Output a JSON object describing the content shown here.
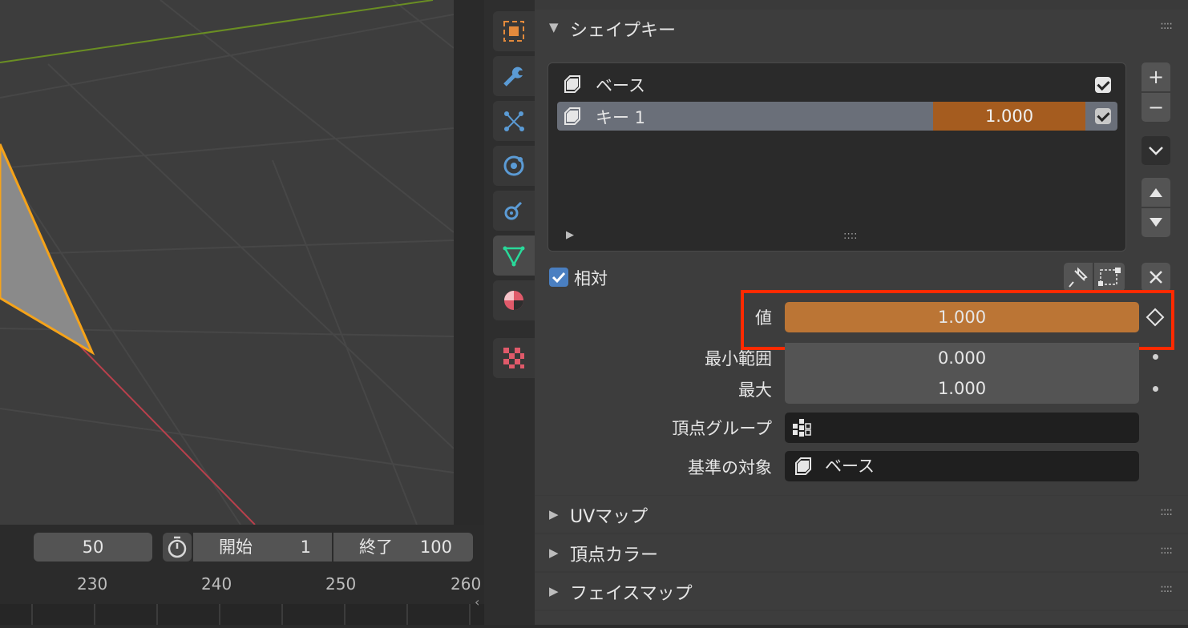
{
  "timeline": {
    "current_frame": "50",
    "start_label": "開始",
    "start_value": "1",
    "end_label": "終了",
    "end_value": "100",
    "ruler_numbers": [
      "230",
      "240",
      "250",
      "260"
    ]
  },
  "tabs": [
    "object-tab",
    "modifier-tab",
    "particles-tab",
    "physics-tab",
    "constraints-tab",
    "data-tab",
    "material-tab",
    "texture-tab"
  ],
  "shape_keys": {
    "title": "シェイプキー",
    "items": [
      {
        "name": "ベース",
        "value": "",
        "checked": true
      },
      {
        "name": "キー 1",
        "value": "1.000",
        "checked": true
      }
    ],
    "relative_label": "相対",
    "value_label": "値",
    "value": "1.000",
    "range_min_label": "最小範囲",
    "range_min": "0.000",
    "max_label": "最大",
    "max": "1.000",
    "vertex_group_label": "頂点グループ",
    "vertex_group_value": "",
    "relative_to_label": "基準の対象",
    "relative_to_value": "ベース",
    "add_symbol": "+",
    "remove_symbol": "−",
    "list_grip": "::::",
    "panel_grip": "::::"
  },
  "panels": [
    "UVマップ",
    "頂点カラー",
    "フェイスマップ"
  ],
  "colors": {
    "accent_orange": "#bb7535",
    "active_row_orange": "#a55c1f",
    "highlight_red": "#ff2a00",
    "checkbox_blue": "#4a7fc1"
  }
}
